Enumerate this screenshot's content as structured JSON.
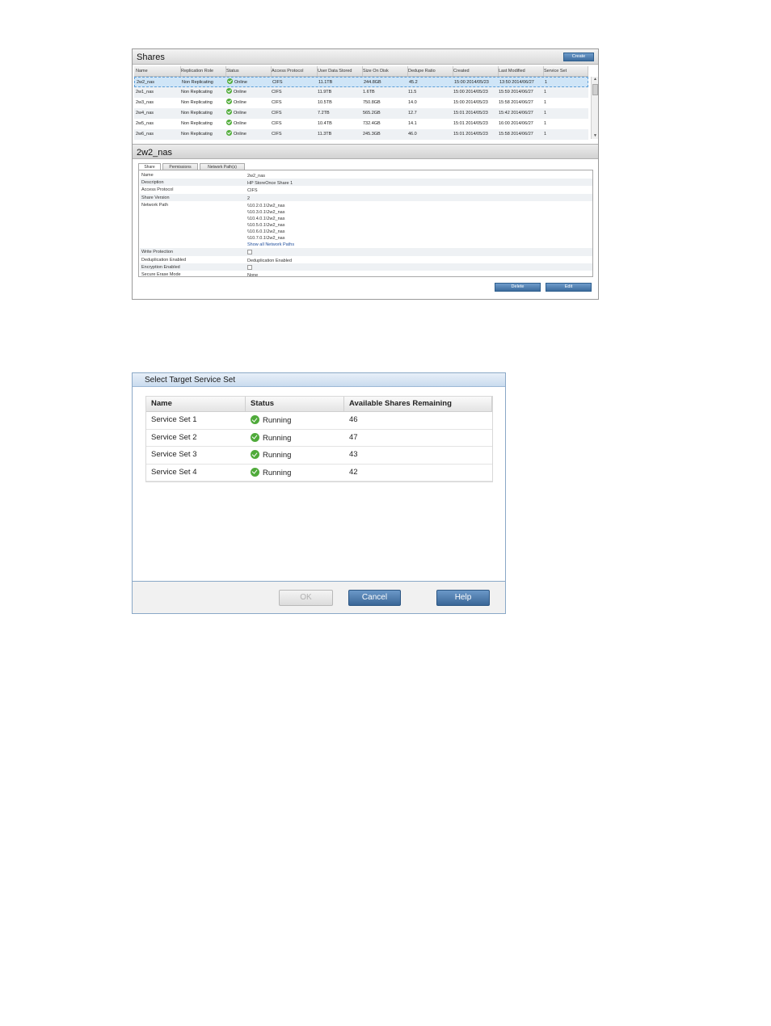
{
  "shares": {
    "title": "Shares",
    "create_label": "Create",
    "columns": [
      "Name",
      "Replication Role",
      "Status",
      "Access Protocol",
      "User Data Stored",
      "Size On Disk",
      "Dedupe Ratio",
      "Created",
      "Last Modified",
      "Service Set"
    ],
    "rows": [
      [
        "2w2_nas",
        "Non Replicating",
        "Online",
        "CIFS",
        "11.1TB",
        "244.8GB",
        "45.2",
        "15:00 2014/05/23",
        "13:50 2014/06/27",
        "1"
      ],
      [
        "2w1_nas",
        "Non Replicating",
        "Online",
        "CIFS",
        "11.9TB",
        "1.6TB",
        "11.5",
        "15:00 2014/05/23",
        "15:59 2014/06/27",
        "1"
      ],
      [
        "2w3_nas",
        "Non Replicating",
        "Online",
        "CIFS",
        "10.5TB",
        "750.8GB",
        "14.0",
        "15:00 2014/05/23",
        "15:58 2014/06/27",
        "1"
      ],
      [
        "2w4_nas",
        "Non Replicating",
        "Online",
        "CIFS",
        "7.2TB",
        "565.2GB",
        "12.7",
        "15:01 2014/05/23",
        "15:42 2014/06/27",
        "1"
      ],
      [
        "2w5_nas",
        "Non Replicating",
        "Online",
        "CIFS",
        "10.4TB",
        "732.4GB",
        "14.1",
        "15:01 2014/05/23",
        "16:00 2014/06/27",
        "1"
      ],
      [
        "2w6_nas",
        "Non Replicating",
        "Online",
        "CIFS",
        "11.3TB",
        "245.3GB",
        "46.0",
        "15:01 2014/05/23",
        "15:58 2014/06/27",
        "1"
      ]
    ]
  },
  "detail": {
    "title": "2w2_nas",
    "tabs": [
      "Share",
      "Permissions",
      "Network Path(s)"
    ],
    "labels": {
      "name": "Name",
      "description": "Description",
      "access_protocol": "Access Protocol",
      "share_version": "Share Version",
      "network_path": "Network Path",
      "write_protection": "Write Protection",
      "dedup_enabled": "Deduplication Enabled",
      "encryption_enabled": "Encryption Enabled",
      "secure_erase_mode": "Secure Erase Mode"
    },
    "values": {
      "name": "2w2_nas",
      "description": "HP StoreOnce Share 1",
      "access_protocol": "CIFS",
      "share_version": "2",
      "network_paths": [
        "\\\\10.2.0.1\\2w2_nas",
        "\\\\10.3.0.1\\2w2_nas",
        "\\\\10.4.0.1\\2w2_nas",
        "\\\\10.5.0.1\\2w2_nas",
        "\\\\10.6.0.1\\2w2_nas",
        "\\\\10.7.0.1\\2w2_nas"
      ],
      "show_all_link": "Show all Network Paths",
      "write_protection": false,
      "dedup_enabled": "Deduplication Enabled",
      "encryption_enabled": false,
      "secure_erase_mode": "None"
    },
    "delete_label": "Delete",
    "edit_label": "Edit"
  },
  "target_dialog": {
    "title": "Select Target Service Set",
    "columns": [
      "Name",
      "Status",
      "Available Shares Remaining"
    ],
    "rows": [
      {
        "name": "Service Set 1",
        "status": "Running",
        "available": "46"
      },
      {
        "name": "Service Set 2",
        "status": "Running",
        "available": "47"
      },
      {
        "name": "Service Set 3",
        "status": "Running",
        "available": "43"
      },
      {
        "name": "Service Set 4",
        "status": "Running",
        "available": "42"
      }
    ],
    "ok_label": "OK",
    "cancel_label": "Cancel",
    "help_label": "Help"
  },
  "colors": {
    "status_ok": "#53ad3c",
    "button_blue": "#3d6c9d",
    "selection": "#cfe5f7"
  }
}
